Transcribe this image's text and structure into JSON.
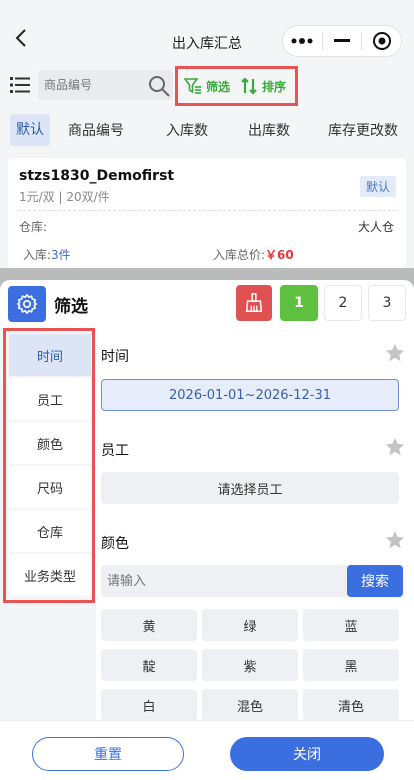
{
  "header": {
    "title": "出入库汇总"
  },
  "search": {
    "placeholder": "商品编号",
    "filter_label": "筛选",
    "sort_label": "排序"
  },
  "tabs": [
    "默认",
    "商品编号",
    "入库数",
    "出库数",
    "库存更改数"
  ],
  "card": {
    "name": "stzs1830_Demofirst",
    "spec": "1元/双 | 20双/件",
    "badge": "默认",
    "warehouse_label": "仓库:",
    "warehouse_value": "大人仓",
    "in_label": "入库:",
    "in_value": "3件",
    "total_label": "入库总价:",
    "total_value": "￥60"
  },
  "panel": {
    "title": "筛选",
    "pages": [
      "1",
      "2",
      "3"
    ],
    "active_page": "1",
    "nav": [
      "时间",
      "员工",
      "颜色",
      "尺码",
      "仓库",
      "业务类型"
    ],
    "active_nav": "时间",
    "sections": {
      "time": {
        "title": "时间",
        "value": "2026-01-01~2026-12-31"
      },
      "employee": {
        "title": "员工",
        "button": "请选择员工"
      },
      "color": {
        "title": "颜色",
        "placeholder": "请输入",
        "search_label": "搜索",
        "chips": [
          "黄",
          "绿",
          "蓝",
          "靛",
          "紫",
          "黑",
          "白",
          "混色",
          "清色"
        ]
      }
    },
    "reset_label": "重置",
    "close_label": "关闭"
  },
  "colors": {
    "primary": "#3b6fe0",
    "green": "#5fbf3f",
    "red": "#e05252",
    "highlight": "#e85454"
  },
  "icons": [
    "back-icon",
    "more-icon",
    "minimize-icon",
    "target-icon",
    "list-icon",
    "search-icon",
    "filter-icon",
    "sort-icon",
    "gear-icon",
    "brush-icon",
    "star-icon"
  ]
}
